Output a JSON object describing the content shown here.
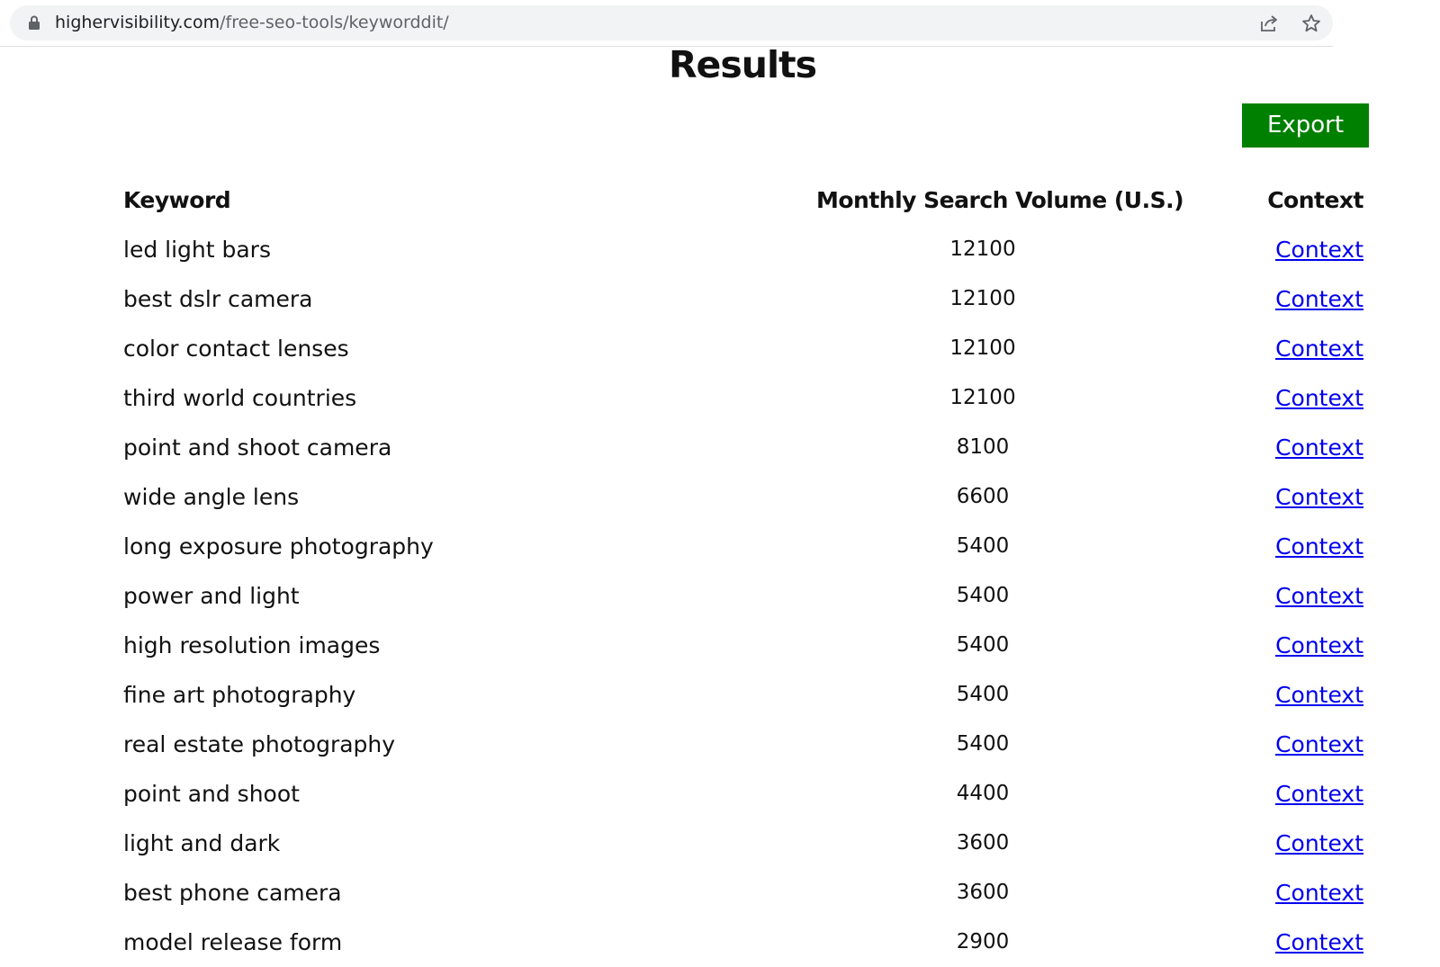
{
  "browser": {
    "url_domain": "highervisibility.com",
    "url_path": "/free-seo-tools/keyworddit/",
    "share_icon": "share-icon",
    "star_icon": "star-icon",
    "lock_icon": "lock-icon"
  },
  "page": {
    "title": "Results",
    "export_label": "Export",
    "export_color": "#008000"
  },
  "table": {
    "headers": {
      "keyword": "Keyword",
      "volume": "Monthly Search Volume (U.S.)",
      "context": "Context"
    },
    "rows": [
      {
        "keyword": "led light bars",
        "volume": "12100",
        "context": "Context"
      },
      {
        "keyword": "best dslr camera",
        "volume": "12100",
        "context": "Context"
      },
      {
        "keyword": "color contact lenses",
        "volume": "12100",
        "context": "Context"
      },
      {
        "keyword": "third world countries",
        "volume": "12100",
        "context": "Context"
      },
      {
        "keyword": "point and shoot camera",
        "volume": "8100",
        "context": "Context"
      },
      {
        "keyword": "wide angle lens",
        "volume": "6600",
        "context": "Context"
      },
      {
        "keyword": "long exposure photography",
        "volume": "5400",
        "context": "Context"
      },
      {
        "keyword": "power and light",
        "volume": "5400",
        "context": "Context"
      },
      {
        "keyword": "high resolution images",
        "volume": "5400",
        "context": "Context"
      },
      {
        "keyword": "fine art photography",
        "volume": "5400",
        "context": "Context"
      },
      {
        "keyword": "real estate photography",
        "volume": "5400",
        "context": "Context"
      },
      {
        "keyword": "point and shoot",
        "volume": "4400",
        "context": "Context"
      },
      {
        "keyword": "light and dark",
        "volume": "3600",
        "context": "Context"
      },
      {
        "keyword": "best phone camera",
        "volume": "3600",
        "context": "Context"
      },
      {
        "keyword": "model release form",
        "volume": "2900",
        "context": "Context"
      }
    ]
  }
}
